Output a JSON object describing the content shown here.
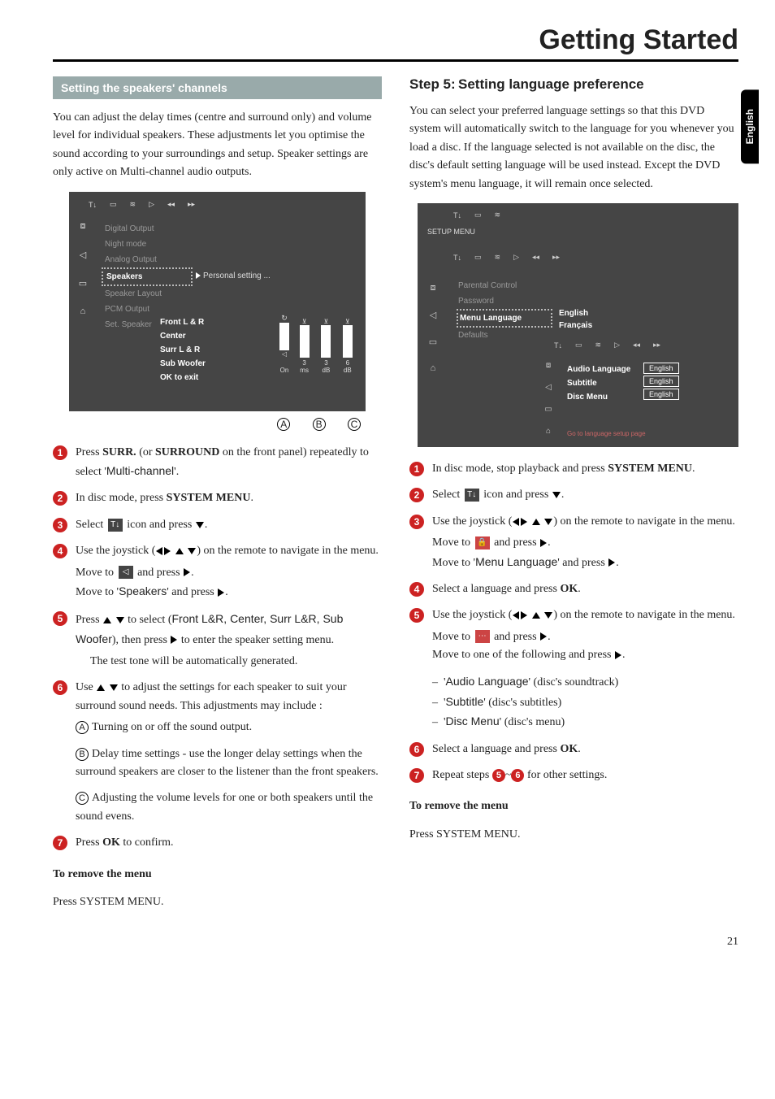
{
  "meta": {
    "chapter": "Getting Started",
    "lang_tab": "English",
    "page_number": "21"
  },
  "left": {
    "section_title": "Setting the speakers' channels",
    "intro": "You can adjust the delay times (centre and surround only) and volume level for individual speakers. These adjustments let you optimise the sound according to your surroundings and setup.  Speaker settings are only active on Multi-channel audio outputs.",
    "fig": {
      "menu": [
        "Digital Output",
        "Night mode",
        "Analog Output",
        "Speakers",
        "Speaker Layout",
        "PCM Output",
        "Set. Speaker"
      ],
      "selected": "Speakers",
      "right_label": "Personal setting ...",
      "submenu": [
        "Front L & R",
        "Center",
        "Surr L & R",
        "Sub Woofer",
        "OK to exit"
      ],
      "gauges": {
        "labels": [
          "On",
          "3 ms",
          "3 dB",
          "6 dB"
        ]
      }
    },
    "callouts": [
      "A",
      "B",
      "C"
    ],
    "steps": {
      "s1_a": "Press ",
      "s1_b": "SURR.",
      "s1_c": " (or ",
      "s1_d": "SURROUND",
      "s1_e": " on the front panel) repeatedly to select '",
      "s1_f": "Multi-channel",
      "s1_g": "'.",
      "s2_a": "In disc mode, press ",
      "s2_b": "SYSTEM MENU",
      "s2_c": ".",
      "s3_a": "Select ",
      "s3_b": " icon and press ",
      "s4_a": "Use the joystick (",
      "s4_b": ") on the remote to navigate in the menu.",
      "s4_m1a": "Move to ",
      "s4_m1b": " and press ",
      "s4_m2a": "Move to '",
      "s4_m2b": "Speakers",
      "s4_m2c": "' and press ",
      "s5_a": "Press ",
      "s5_b": " to select (",
      "s5_c": "Front L&R, Center, Surr L&R, Sub Woofer",
      "s5_d": "), then press ",
      "s5_e": " to enter the speaker setting menu.",
      "s5_note": "The test tone will be automatically generated.",
      "s6_a": "Use ",
      "s6_b": " to adjust the settings for each speaker to suit your surround sound needs.  This adjustments may include :",
      "s6_A": "Turning on or off the sound output.",
      "s6_B": "Delay time settings - use the longer delay settings when the surround speakers are closer to the listener than the front speakers.",
      "s6_C": "Adjusting the volume levels for one or both speakers until the sound evens.",
      "s7_a": "Press ",
      "s7_b": "OK",
      "s7_c": " to confirm."
    },
    "remove_head": "To remove the menu",
    "remove_body": "Press SYSTEM MENU."
  },
  "right": {
    "step_lead": "Step 5:",
    "step_title": "Setting language preference",
    "intro": "You can select your preferred language settings so that this DVD system will automatically switch to the language for you whenever you load a disc.  If the language selected is not available on the disc, the disc's default setting language will be used instead.  Except the DVD system's menu language, it will remain once selected.",
    "fig": {
      "setup": "SETUP MENU",
      "menu": [
        "Parental Control",
        "Password",
        "Menu Language",
        "Defaults"
      ],
      "selected": "Menu Language",
      "opts": [
        "English",
        "Français"
      ],
      "l3_list": [
        "Audio Language",
        "Subtitle",
        "Disc Menu"
      ],
      "l3_vals": [
        "English",
        "English",
        "English"
      ],
      "note": "Go to language setup page"
    },
    "steps": {
      "s1_a": "In disc mode, stop playback and press ",
      "s1_b": "SYSTEM MENU",
      "s1_c": ".",
      "s2_a": "Select ",
      "s2_b": " icon and press ",
      "s3_a": "Use the joystick (",
      "s3_b": ") on the remote to navigate in the menu.",
      "s3_m1a": "Move to ",
      "s3_m1b": " and press ",
      "s3_m2a": "Move to '",
      "s3_m2b": "Menu Language",
      "s3_m2c": "' and press ",
      "s4_a": "Select a language and press ",
      "s4_b": "OK",
      "s4_c": ".",
      "s5_a": "Use the joystick (",
      "s5_b": ") on the remote to navigate in the menu.",
      "s5_m1a": "Move to ",
      "s5_m1b": " and press ",
      "s5_m2": "Move to one of the following and press ",
      "s5_o1a": "'",
      "s5_o1b": "Audio Language",
      "s5_o1c": "' (disc's soundtrack)",
      "s5_o2a": "'",
      "s5_o2b": "Subtitle",
      "s5_o2c": "' (disc's subtitles)",
      "s5_o3a": "'",
      "s5_o3b": "Disc Menu",
      "s5_o3c": "' (disc's menu)",
      "s6_a": "Select a language and press ",
      "s6_b": "OK",
      "s6_c": ".",
      "s7_a": "Repeat steps ",
      "s7_b": "~",
      "s7_c": " for other settings."
    },
    "remove_head": "To remove the menu",
    "remove_body": "Press SYSTEM MENU."
  }
}
